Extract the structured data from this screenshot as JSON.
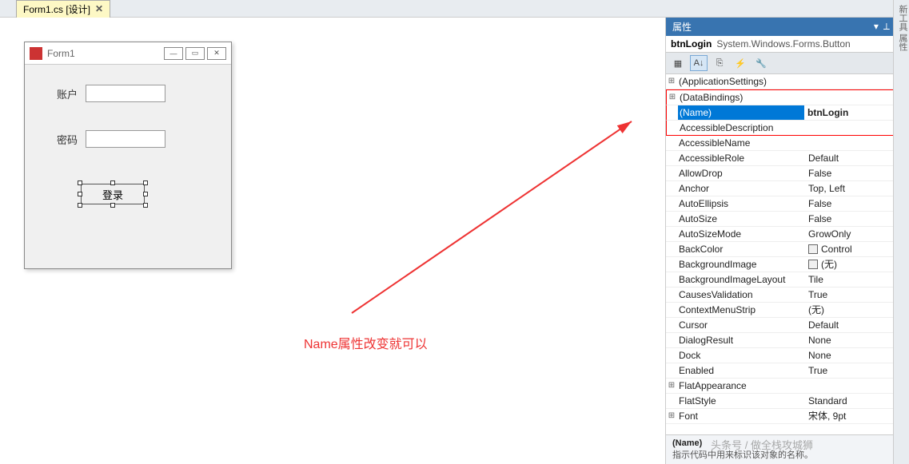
{
  "tab": {
    "title": "Form1.cs [设计]",
    "close": "✕"
  },
  "form": {
    "title": "Form1",
    "account_label": "账户",
    "password_label": "密码",
    "login_btn": "登录"
  },
  "annotation": "Name属性改变就可以",
  "panel": {
    "title": "属性",
    "pin": "⟂",
    "close": "✕",
    "object_name": "btnLogin",
    "object_type": "System.Windows.Forms.Button"
  },
  "toolbar": {
    "cat": "▦",
    "az": "A↓",
    "page": "⎘",
    "bolt": "⚡",
    "wrench": "🔧"
  },
  "props": [
    {
      "name": "(ApplicationSettings)",
      "value": "",
      "expand": "⊞"
    },
    {
      "name": "(DataBindings)",
      "value": "",
      "expand": "⊞",
      "redtop": true
    },
    {
      "name": "(Name)",
      "value": "btnLogin",
      "selected": true,
      "red": true
    },
    {
      "name": "AccessibleDescription",
      "value": "",
      "red": true
    },
    {
      "name": "AccessibleName",
      "value": ""
    },
    {
      "name": "AccessibleRole",
      "value": "Default"
    },
    {
      "name": "AllowDrop",
      "value": "False"
    },
    {
      "name": "Anchor",
      "value": "Top, Left"
    },
    {
      "name": "AutoEllipsis",
      "value": "False"
    },
    {
      "name": "AutoSize",
      "value": "False"
    },
    {
      "name": "AutoSizeMode",
      "value": "GrowOnly"
    },
    {
      "name": "BackColor",
      "value": "Control",
      "swatch": true
    },
    {
      "name": "BackgroundImage",
      "value": "(无)",
      "swatch": true
    },
    {
      "name": "BackgroundImageLayout",
      "value": "Tile"
    },
    {
      "name": "CausesValidation",
      "value": "True"
    },
    {
      "name": "ContextMenuStrip",
      "value": "(无)"
    },
    {
      "name": "Cursor",
      "value": "Default"
    },
    {
      "name": "DialogResult",
      "value": "None"
    },
    {
      "name": "Dock",
      "value": "None"
    },
    {
      "name": "Enabled",
      "value": "True"
    },
    {
      "name": "FlatAppearance",
      "value": "",
      "expand": "⊞"
    },
    {
      "name": "FlatStyle",
      "value": "Standard"
    },
    {
      "name": "Font",
      "value": "宋体, 9pt",
      "expand": "⊞"
    }
  ],
  "footer": {
    "name": "(Name)",
    "desc": "指示代码中用来标识该对象的名称。"
  },
  "watermark": "头条号 / 做全栈攻城狮",
  "vtabs": "新工具  属性"
}
